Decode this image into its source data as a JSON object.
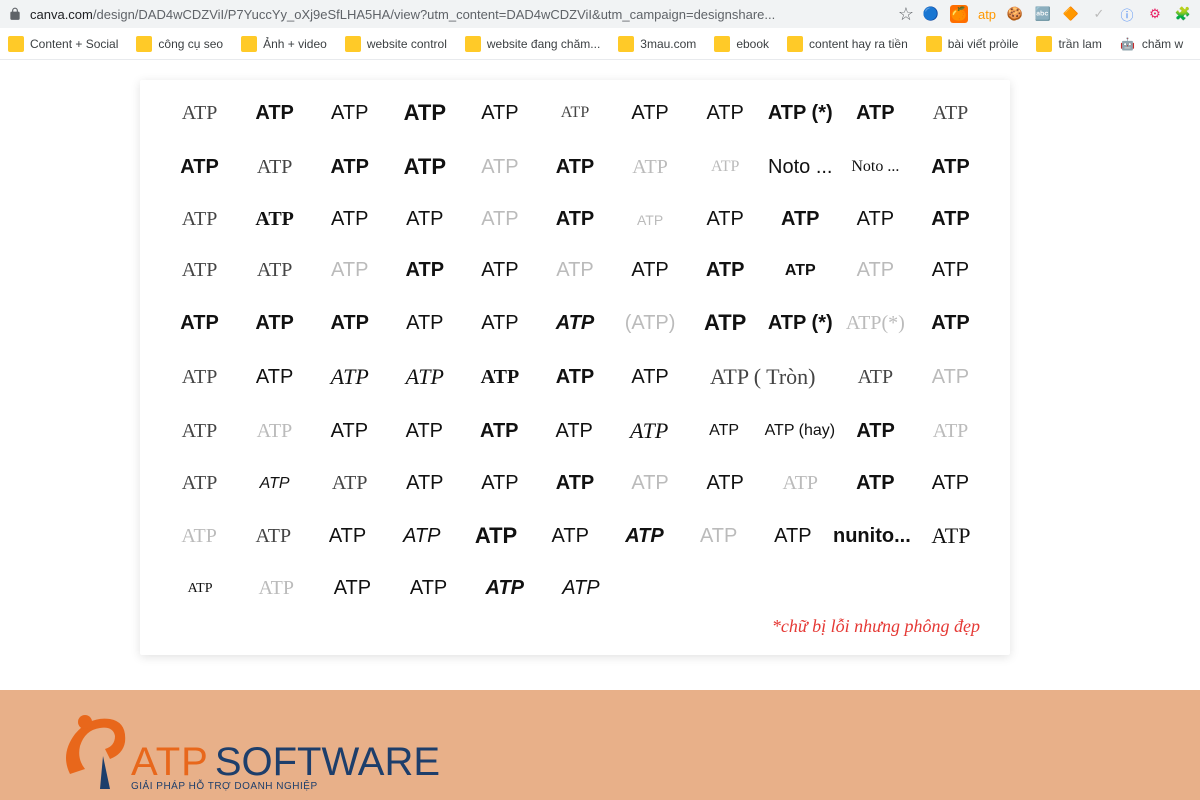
{
  "addr": {
    "url_domain": "canva.com",
    "url_rest": "/design/DAD4wCDZViI/P7YuccYy_oXj9eSfLHA5HA/view?utm_content=DAD4wCDZViI&utm_campaign=designshare..."
  },
  "bookmarks": [
    "Content + Social",
    "công cụ seo",
    "Ảnh + video",
    "website control",
    "website đang chăm...",
    "3mau.com",
    "ebook",
    "content hay ra tiền",
    "bài viết pròile",
    "trần lam",
    "chăm w"
  ],
  "rows": [
    [
      {
        "t": "ATP",
        "c": "s-thin"
      },
      {
        "t": "ATP",
        "c": "s-bold"
      },
      {
        "t": "ATP",
        "c": "s-med"
      },
      {
        "t": "ATP",
        "c": "s-black xl"
      },
      {
        "t": "ATP",
        "c": "s-med"
      },
      {
        "t": "ATP",
        "c": "s-thin sm"
      },
      {
        "t": "ATP",
        "c": "s-med"
      },
      {
        "t": "ATP",
        "c": "s-med"
      },
      {
        "t": "ATP (*)",
        "c": "s-bold"
      },
      {
        "t": "ATP",
        "c": "s-bold"
      },
      {
        "t": "ATP",
        "c": "s-thin"
      }
    ],
    [
      {
        "t": "ATP",
        "c": "s-black"
      },
      {
        "t": "ATP",
        "c": "s-thin"
      },
      {
        "t": "ATP",
        "c": "s-bold"
      },
      {
        "t": "ATP",
        "c": "s-black xl"
      },
      {
        "t": "ATP",
        "c": "s-light"
      },
      {
        "t": "ATP",
        "c": "s-black"
      },
      {
        "t": "ATP",
        "c": "s-light s-thin"
      },
      {
        "t": "ATP",
        "c": "s-light s-serif sm"
      },
      {
        "t": "Noto ...",
        "c": "s-med"
      },
      {
        "t": "Noto ...",
        "c": "s-serif sm"
      },
      {
        "t": "ATP",
        "c": "s-cond s-bold"
      }
    ],
    [
      {
        "t": "ATP",
        "c": "s-thin"
      },
      {
        "t": "ATP",
        "c": "s-bold s-serif"
      },
      {
        "t": "ATP",
        "c": "s-med"
      },
      {
        "t": "ATP",
        "c": "s-med"
      },
      {
        "t": "ATP",
        "c": "s-light"
      },
      {
        "t": "ATP",
        "c": "s-black"
      },
      {
        "t": "ATP",
        "c": "s-light xs"
      },
      {
        "t": "ATP",
        "c": "s-med"
      },
      {
        "t": "ATP",
        "c": "s-black"
      },
      {
        "t": "ATP",
        "c": "s-med"
      },
      {
        "t": "ATP",
        "c": "s-bold"
      }
    ],
    [
      {
        "t": "ATP",
        "c": "s-thin"
      },
      {
        "t": "ATP",
        "c": "s-thin"
      },
      {
        "t": "ATP",
        "c": "s-light"
      },
      {
        "t": "ATP",
        "c": "s-bold"
      },
      {
        "t": "ATP",
        "c": "s-med"
      },
      {
        "t": "ATP",
        "c": "s-light"
      },
      {
        "t": "ATP",
        "c": "s-med"
      },
      {
        "t": "ATP",
        "c": "s-black"
      },
      {
        "t": "ATP",
        "c": "s-cond s-bold sm"
      },
      {
        "t": "ATP",
        "c": "s-light"
      },
      {
        "t": "ATP",
        "c": "s-med"
      }
    ],
    [
      {
        "t": "ATP",
        "c": "s-black"
      },
      {
        "t": "ATP",
        "c": "s-black"
      },
      {
        "t": "ATP",
        "c": "s-black"
      },
      {
        "t": "ATP",
        "c": "s-med"
      },
      {
        "t": "ATP",
        "c": "s-med"
      },
      {
        "t": "ATP",
        "c": "s-bold s-italic"
      },
      {
        "t": "(ATP)",
        "c": "s-light"
      },
      {
        "t": "ATP",
        "c": "s-black xl"
      },
      {
        "t": "ATP (*)",
        "c": "s-black"
      },
      {
        "t": "ATP(*)",
        "c": "s-light s-serif"
      },
      {
        "t": "ATP",
        "c": "s-black"
      }
    ],
    [
      {
        "t": "ATP",
        "c": "s-thin"
      },
      {
        "t": "ATP",
        "c": "s-med"
      },
      {
        "t": "ATP",
        "c": "s-script s-italic"
      },
      {
        "t": "ATP",
        "c": "s-script s-italic"
      },
      {
        "t": "ATP",
        "c": "s-black s-serif"
      },
      {
        "t": "ATP",
        "c": "s-bold"
      },
      {
        "t": "ATP",
        "c": "s-med"
      },
      {
        "t": "ATP ( Tròn)",
        "c": "s-thin xl",
        "span": 2
      },
      {
        "t": "ATP",
        "c": "s-thin"
      },
      {
        "t": "ATP",
        "c": "s-light"
      }
    ],
    [
      {
        "t": "ATP",
        "c": "s-thin s-serif"
      },
      {
        "t": "ATP",
        "c": "s-light s-serif"
      },
      {
        "t": "ATP",
        "c": "s-med"
      },
      {
        "t": "ATP",
        "c": "s-med"
      },
      {
        "t": "ATP",
        "c": "s-bold"
      },
      {
        "t": "ATP",
        "c": "s-cond"
      },
      {
        "t": "ATP",
        "c": "s-script s-italic"
      },
      {
        "t": "ATP",
        "c": "sm"
      },
      {
        "t": "ATP (hay)",
        "c": "sm"
      },
      {
        "t": "ATP",
        "c": "s-bold"
      },
      {
        "t": "ATP",
        "c": "s-light s-serif"
      }
    ],
    [
      {
        "t": "ATP",
        "c": "s-thin s-serif"
      },
      {
        "t": "ATP",
        "c": "s-italic sm"
      },
      {
        "t": "ATP",
        "c": "s-thin"
      },
      {
        "t": "ATP",
        "c": "s-med"
      },
      {
        "t": "ATP",
        "c": "s-med"
      },
      {
        "t": "ATP",
        "c": "s-black"
      },
      {
        "t": "ATP",
        "c": "s-light"
      },
      {
        "t": "ATP",
        "c": "s-cond"
      },
      {
        "t": "ATP",
        "c": "s-light s-thin"
      },
      {
        "t": "ATP",
        "c": "s-black"
      },
      {
        "t": "ATP",
        "c": "s-med"
      }
    ],
    [
      {
        "t": "ATP",
        "c": "s-light s-thin"
      },
      {
        "t": "ATP",
        "c": "s-thin"
      },
      {
        "t": "ATP",
        "c": "s-med"
      },
      {
        "t": "ATP",
        "c": "s-italic"
      },
      {
        "t": "ATP",
        "c": "s-black xl"
      },
      {
        "t": "ATP",
        "c": "s-med"
      },
      {
        "t": "ATP",
        "c": "s-bold s-italic"
      },
      {
        "t": "ATP",
        "c": "s-light"
      },
      {
        "t": "ATP",
        "c": "s-med"
      },
      {
        "t": "nunito...",
        "c": "s-bold"
      },
      {
        "t": "ATP",
        "c": "s-script xl"
      }
    ]
  ],
  "lastRow": [
    {
      "t": "ATP",
      "c": "s-script xs"
    },
    {
      "t": "ATP",
      "c": "s-light s-thin"
    },
    {
      "t": "ATP",
      "c": "s-med"
    },
    {
      "t": "ATP",
      "c": "s-cond"
    },
    {
      "t": "ATP",
      "c": "s-black s-italic"
    },
    {
      "t": "ATP",
      "c": "s-italic"
    }
  ],
  "note": "*chữ bị lỗi nhưng phông đẹp",
  "logo": {
    "brand1": "ATP",
    "brand2": "SOFTWARE",
    "tag": "GIẢI PHÁP HỖ TRỢ DOANH NGHIỆP"
  }
}
